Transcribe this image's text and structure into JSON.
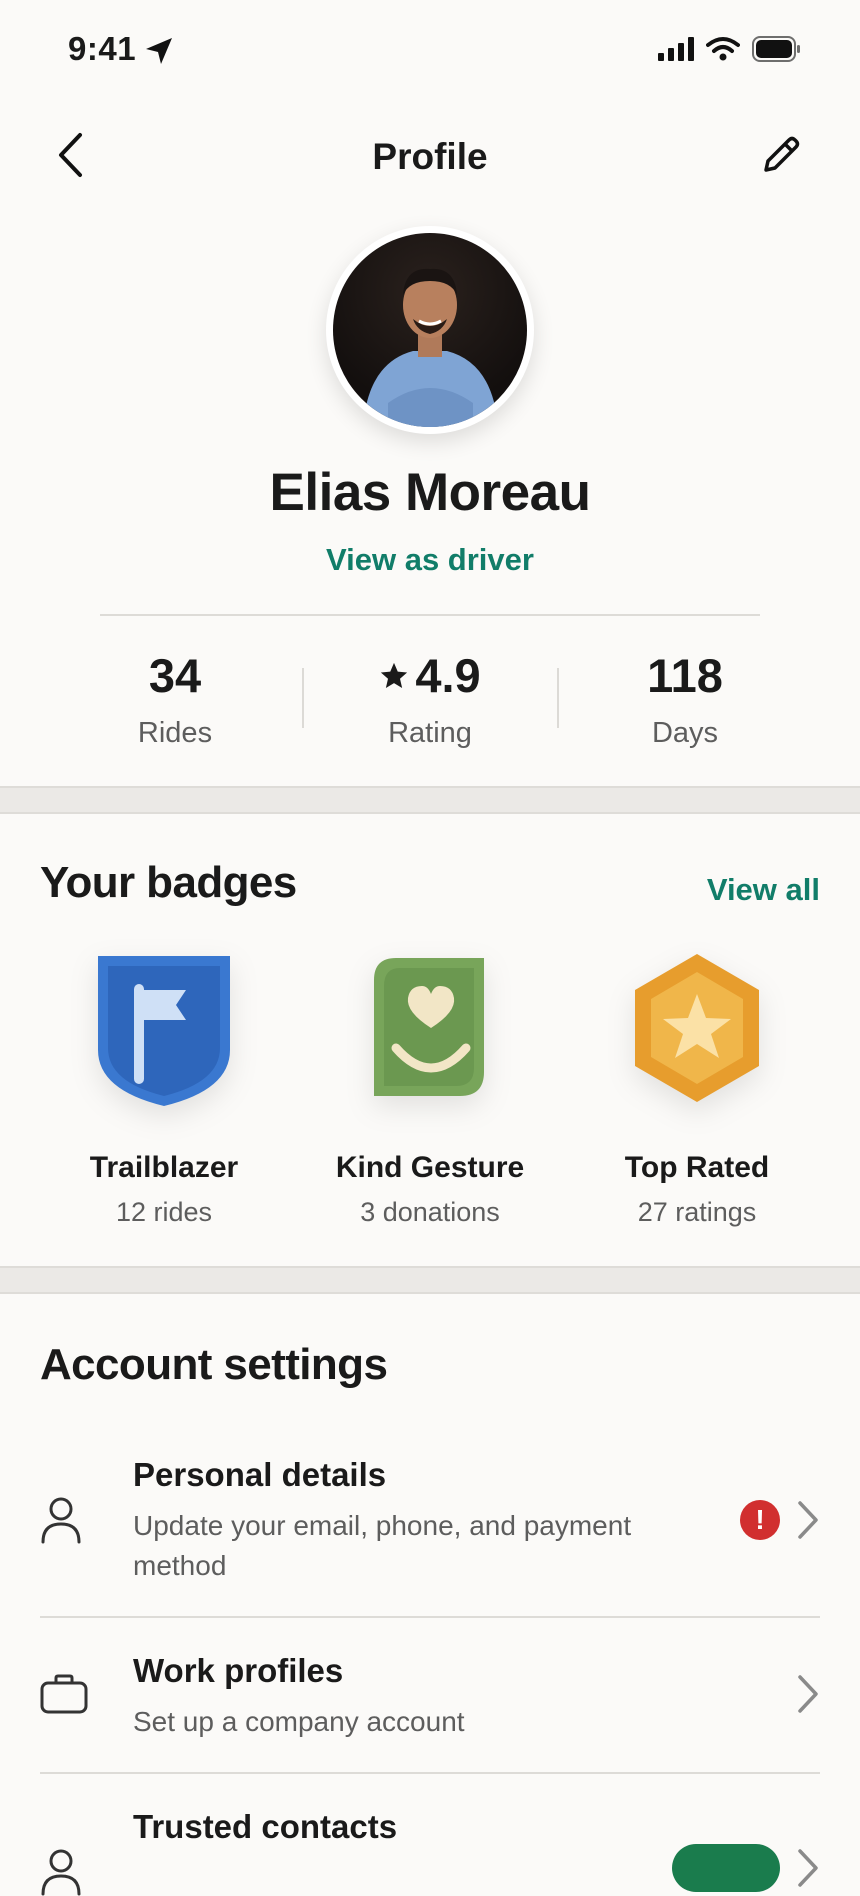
{
  "status_bar": {
    "time": "9:41"
  },
  "header": {
    "title": "Profile"
  },
  "profile": {
    "name": "Elias Moreau",
    "view_as_driver": "View as driver"
  },
  "stats": [
    {
      "value": "34",
      "label": "Rides"
    },
    {
      "value": "4.9",
      "label": "Rating"
    },
    {
      "value": "118",
      "label": "Days"
    }
  ],
  "badges_section": {
    "title": "Your badges",
    "view_all": "View all",
    "items": [
      {
        "name": "Trailblazer",
        "sub": "12 rides",
        "icon": "flag-shield-icon",
        "color": "#3a78d0"
      },
      {
        "name": "Kind Gesture",
        "sub": "3 donations",
        "icon": "heart-smile-icon",
        "color": "#78a55a"
      },
      {
        "name": "Top Rated",
        "sub": "27 ratings",
        "icon": "star-hexagon-icon",
        "color": "#e79d2d"
      }
    ]
  },
  "account_settings": {
    "title": "Account settings",
    "items": [
      {
        "title": "Personal details",
        "subtitle": "Update your email, phone, and payment method",
        "icon": "person-icon",
        "alert": "!"
      },
      {
        "title": "Work profiles",
        "subtitle": "Set up a company account",
        "icon": "briefcase-icon"
      },
      {
        "title": "Trusted contacts",
        "icon": "person-icon"
      }
    ]
  },
  "colors": {
    "accent": "#117d69",
    "alert": "#d12f2f",
    "new_pill": "#1a7c4d"
  }
}
